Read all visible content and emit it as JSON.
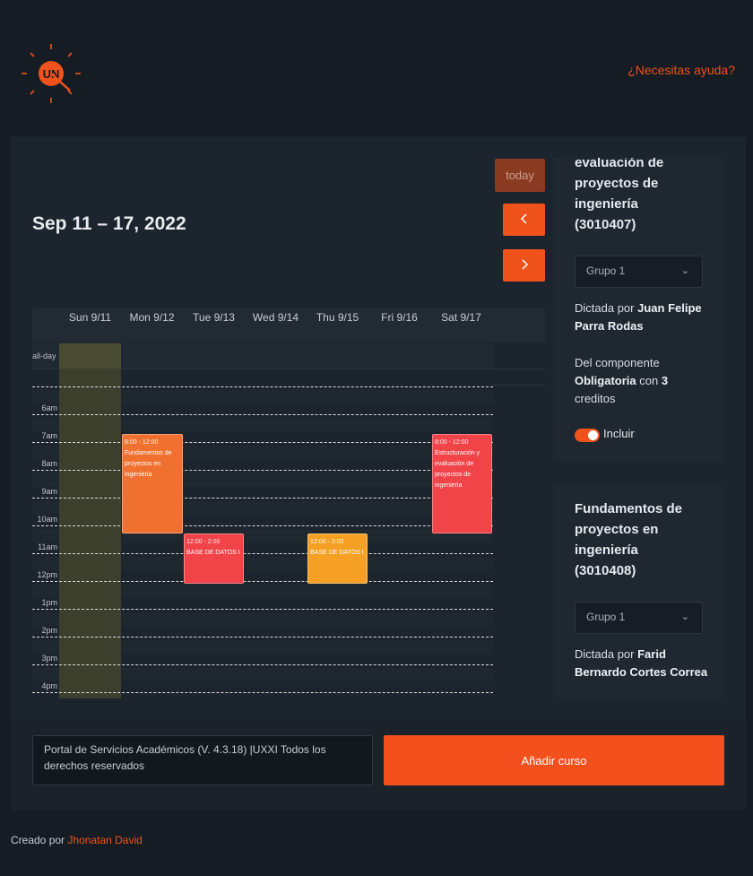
{
  "header": {
    "logo_label": "UN",
    "help_link": "¿Necesitas ayuda?"
  },
  "calendar": {
    "title": "Sep 11 – 17, 2022",
    "today_label": "today",
    "prev_icon": "chevron-left-icon",
    "next_icon": "chevron-right-icon",
    "days": [
      "Sun 9/11",
      "Mon 9/12",
      "Tue 9/13",
      "Wed 9/14",
      "Thu 9/15",
      "Fri 9/16",
      "Sat 9/17"
    ],
    "allday_label": "all-day",
    "times": [
      "6am",
      "7am",
      "8am",
      "9am",
      "10am",
      "11am",
      "12pm",
      "1pm",
      "2pm",
      "3pm",
      "4pm"
    ],
    "events": [
      {
        "time": "8:00 - 12:00",
        "title": "Fundamentos de proyectos en ingenieria",
        "day": "Mon 9/12",
        "color": "#f07030"
      },
      {
        "time": "12:00 - 2:00",
        "title": "BASE DE DATOS I",
        "day": "Tue 9/13",
        "color": "#f04448"
      },
      {
        "time": "12:00 - 2:00",
        "title": "BASE DE DATOS I",
        "day": "Thu 9/15",
        "color": "#f5a024"
      },
      {
        "time": "8:00 - 12:00",
        "title": "Estructuración y evaluación de proyectos de ingenieria",
        "day": "Sat 9/17",
        "color": "#f04448"
      }
    ]
  },
  "courses": [
    {
      "title": "evaluación de proyectos de ingeniería",
      "code": "(3010407)",
      "group": "Grupo 1",
      "taught_prefix": "Dictada por",
      "teacher": "Juan Felipe Parra Rodas",
      "component_prefix": "Del componente",
      "component": "Obligatoria",
      "credits_prefix": "con",
      "credits": "3",
      "credits_suffix": "creditos",
      "include_label": "Incluir"
    },
    {
      "title": "Fundamentos de proyectos en ingeniería",
      "code": "(3010408)",
      "group": "Grupo 1",
      "taught_prefix": "Dictada por",
      "teacher": "Farid Bernardo Cortes Correa"
    }
  ],
  "footer": {
    "portal_text": "Portal de Servicios Académicos (V. 4.3.18) |UXXI Todos los derechos reservados",
    "add_button": "Añadir curso",
    "credit_prefix": "Creado por",
    "credit_author": "Jhonatan David"
  },
  "colors": {
    "accent": "#f0521c",
    "background": "#151c24",
    "panel": "#1c242d"
  }
}
